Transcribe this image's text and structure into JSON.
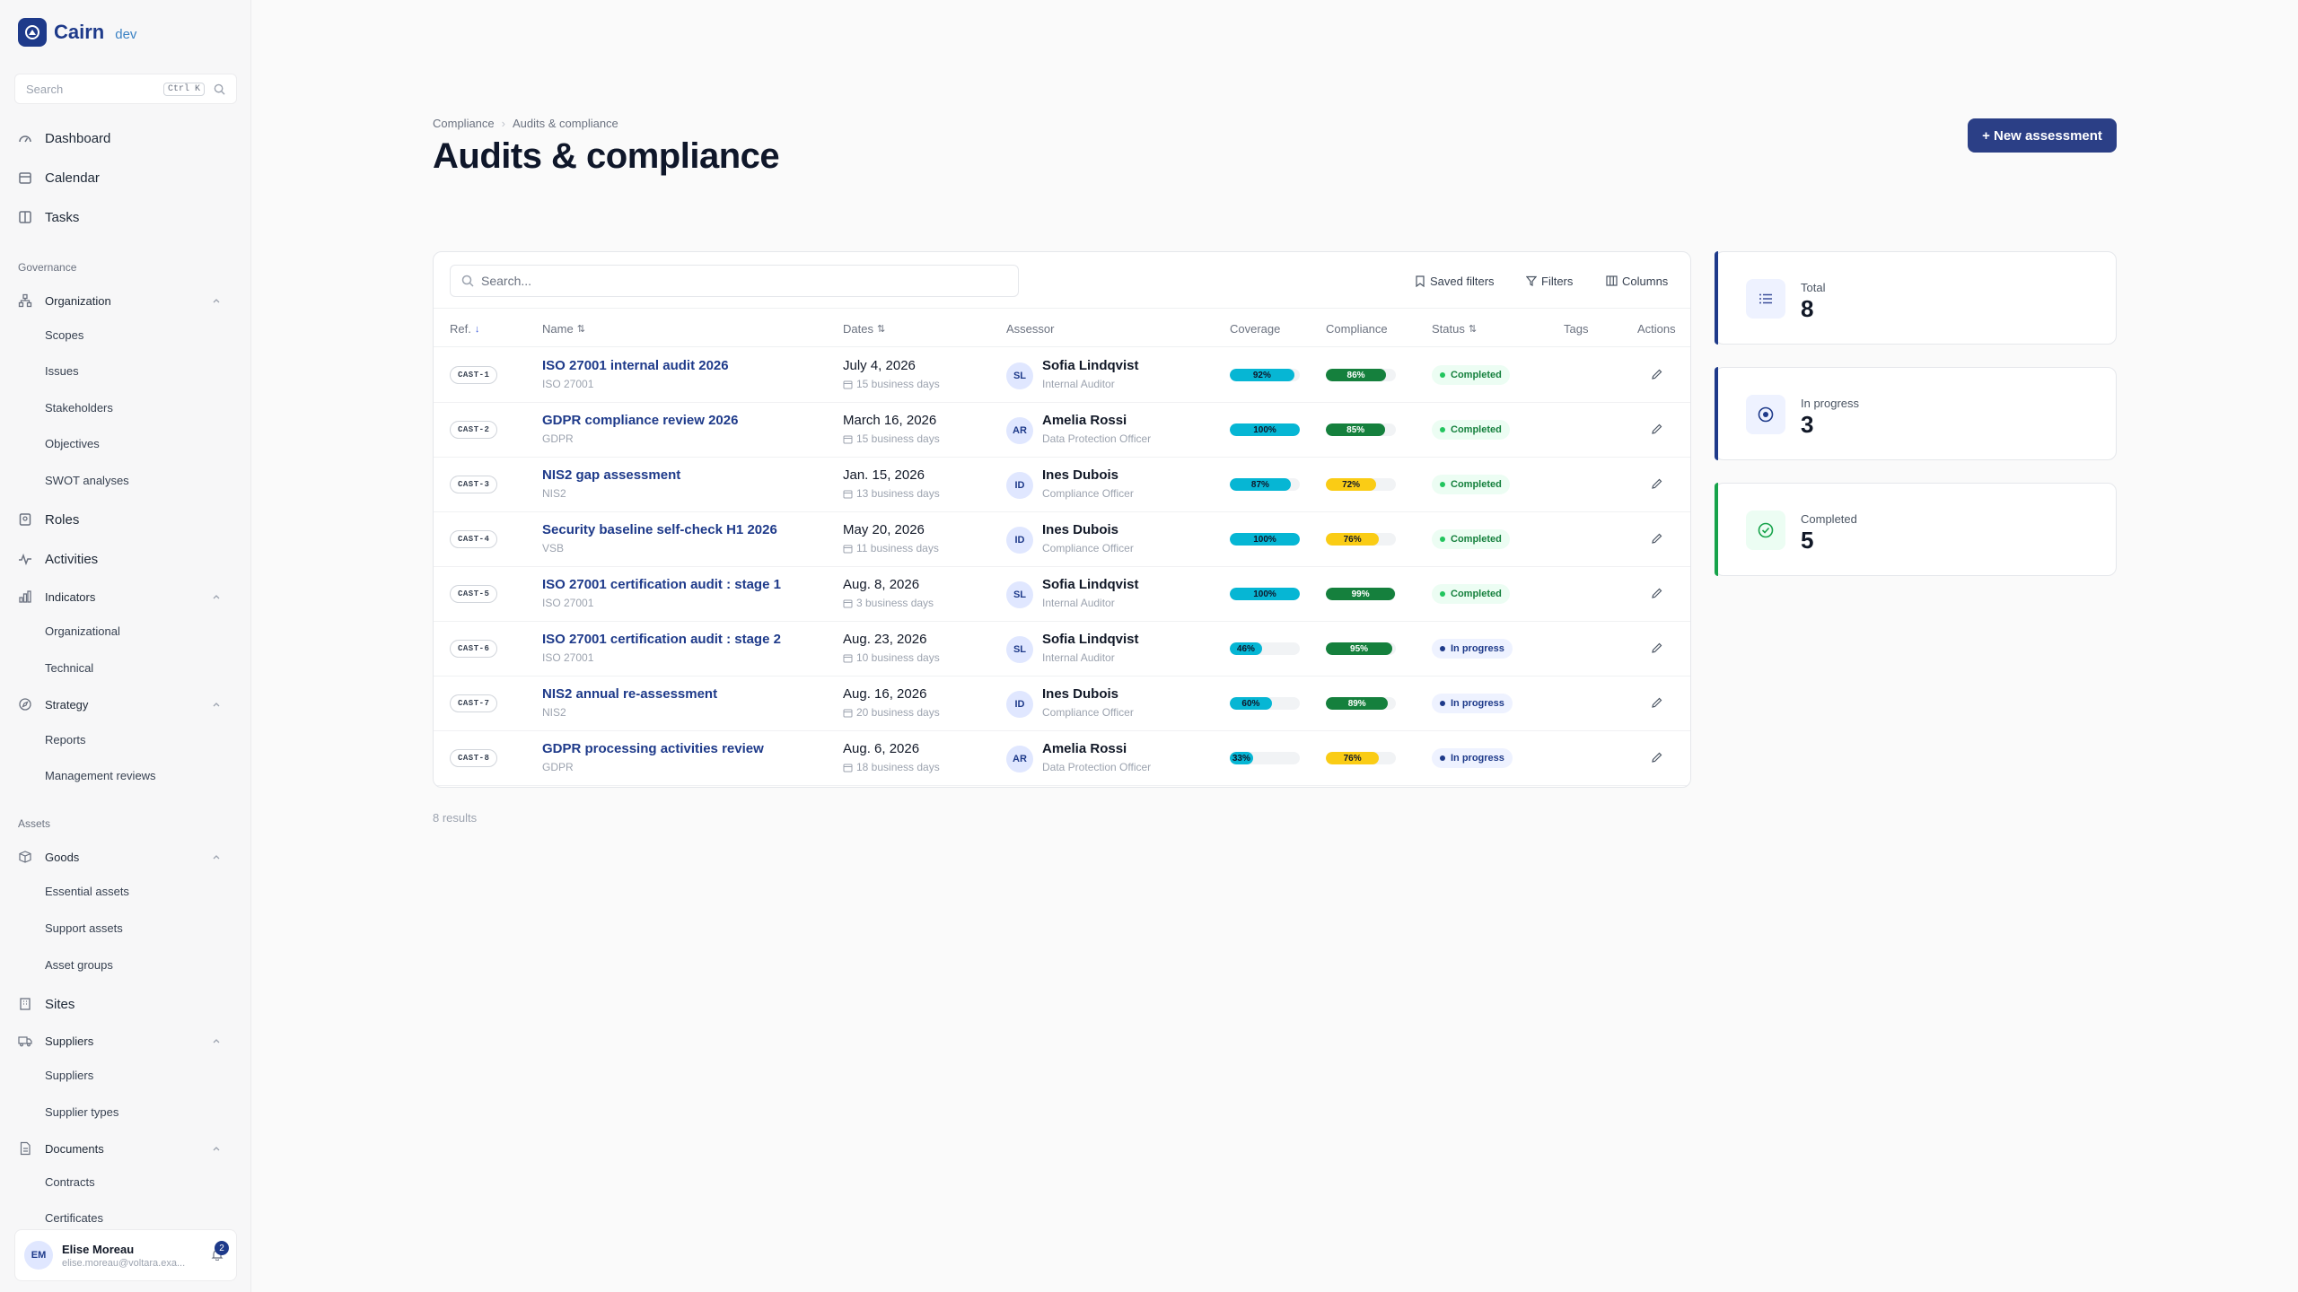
{
  "app": {
    "name": "Cairn",
    "env": "dev"
  },
  "sidebar": {
    "search_placeholder": "Search",
    "search_shortcut": "Ctrl K",
    "top_items": [
      {
        "label": "Dashboard",
        "icon": "dashboard-icon"
      },
      {
        "label": "Calendar",
        "icon": "calendar-icon"
      },
      {
        "label": "Tasks",
        "icon": "tasks-icon"
      }
    ],
    "governance_label": "Governance",
    "organization": {
      "label": "Organization",
      "children": [
        "Scopes",
        "Issues",
        "Stakeholders",
        "Objectives",
        "SWOT analyses"
      ]
    },
    "roles": "Roles",
    "activities": "Activities",
    "indicators": {
      "label": "Indicators",
      "children": [
        "Organizational",
        "Technical"
      ]
    },
    "strategy": {
      "label": "Strategy",
      "children": [
        "Reports",
        "Management reviews"
      ]
    },
    "assets_label": "Assets",
    "goods": {
      "label": "Goods",
      "children": [
        "Essential assets",
        "Support assets",
        "Asset groups"
      ]
    },
    "sites": "Sites",
    "suppliers": {
      "label": "Suppliers",
      "children": [
        "Suppliers",
        "Supplier types"
      ]
    },
    "documents": {
      "label": "Documents",
      "children": [
        "Contracts",
        "Certificates"
      ]
    },
    "user": {
      "initials": "EM",
      "name": "Elise Moreau",
      "email": "elise.moreau@voltara.exa...",
      "notifications": "2"
    }
  },
  "header": {
    "breadcrumb": [
      "Compliance",
      "Audits & compliance"
    ],
    "title": "Audits & compliance",
    "new_button": "+ New assessment"
  },
  "table": {
    "search_placeholder": "Search...",
    "toolbar": {
      "saved_filters": "Saved filters",
      "filters": "Filters",
      "columns": "Columns"
    },
    "columns": {
      "ref": "Ref.",
      "name": "Name",
      "dates": "Dates",
      "assessor": "Assessor",
      "coverage": "Coverage",
      "compliance": "Compliance",
      "status": "Status",
      "tags": "Tags",
      "actions": "Actions"
    },
    "rows": [
      {
        "ref": "CAST-1",
        "name": "ISO 27001 internal audit 2026",
        "framework": "ISO 27001",
        "date": "July 4, 2026",
        "duration": "15 business days",
        "initials": "SL",
        "assessor": "Sofia Lindqvist",
        "role": "Internal Auditor",
        "coverage": 92,
        "coverage_label": "92%",
        "compliance": 86,
        "compliance_label": "86%",
        "compliance_color": "#15803d",
        "status": "Completed"
      },
      {
        "ref": "CAST-2",
        "name": "GDPR compliance review 2026",
        "framework": "GDPR",
        "date": "March 16, 2026",
        "duration": "15 business days",
        "initials": "AR",
        "assessor": "Amelia Rossi",
        "role": "Data Protection Officer",
        "coverage": 100,
        "coverage_label": "100%",
        "compliance": 85,
        "compliance_label": "85%",
        "compliance_color": "#15803d",
        "status": "Completed"
      },
      {
        "ref": "CAST-3",
        "name": "NIS2 gap assessment",
        "framework": "NIS2",
        "date": "Jan. 15, 2026",
        "duration": "13 business days",
        "initials": "ID",
        "assessor": "Ines Dubois",
        "role": "Compliance Officer",
        "coverage": 87,
        "coverage_label": "87%",
        "compliance": 72,
        "compliance_label": "72%",
        "compliance_color": "#facc15",
        "status": "Completed"
      },
      {
        "ref": "CAST-4",
        "name": "Security baseline self-check H1 2026",
        "framework": "VSB",
        "date": "May 20, 2026",
        "duration": "11 business days",
        "initials": "ID",
        "assessor": "Ines Dubois",
        "role": "Compliance Officer",
        "coverage": 100,
        "coverage_label": "100%",
        "compliance": 76,
        "compliance_label": "76%",
        "compliance_color": "#facc15",
        "status": "Completed"
      },
      {
        "ref": "CAST-5",
        "name": "ISO 27001 certification audit : stage 1",
        "framework": "ISO 27001",
        "date": "Aug. 8, 2026",
        "duration": "3 business days",
        "initials": "SL",
        "assessor": "Sofia Lindqvist",
        "role": "Internal Auditor",
        "coverage": 100,
        "coverage_label": "100%",
        "compliance": 99,
        "compliance_label": "99%",
        "compliance_color": "#15803d",
        "status": "Completed"
      },
      {
        "ref": "CAST-6",
        "name": "ISO 27001 certification audit : stage 2",
        "framework": "ISO 27001",
        "date": "Aug. 23, 2026",
        "duration": "10 business days",
        "initials": "SL",
        "assessor": "Sofia Lindqvist",
        "role": "Internal Auditor",
        "coverage": 46,
        "coverage_label": "46%",
        "compliance": 95,
        "compliance_label": "95%",
        "compliance_color": "#15803d",
        "status": "In progress"
      },
      {
        "ref": "CAST-7",
        "name": "NIS2 annual re-assessment",
        "framework": "NIS2",
        "date": "Aug. 16, 2026",
        "duration": "20 business days",
        "initials": "ID",
        "assessor": "Ines Dubois",
        "role": "Compliance Officer",
        "coverage": 60,
        "coverage_label": "60%",
        "compliance": 89,
        "compliance_label": "89%",
        "compliance_color": "#15803d",
        "status": "In progress"
      },
      {
        "ref": "CAST-8",
        "name": "GDPR processing activities review",
        "framework": "GDPR",
        "date": "Aug. 6, 2026",
        "duration": "18 business days",
        "initials": "AR",
        "assessor": "Amelia Rossi",
        "role": "Data Protection Officer",
        "coverage": 33,
        "coverage_label": "33%",
        "compliance": 76,
        "compliance_label": "76%",
        "compliance_color": "#facc15",
        "status": "In progress"
      }
    ],
    "results": "8 results"
  },
  "stats": [
    {
      "label": "Total",
      "value": "8",
      "color": "#1e3a8a",
      "icon": "list-icon"
    },
    {
      "label": "In progress",
      "value": "3",
      "color": "#1e3a8a",
      "icon": "target-icon"
    },
    {
      "label": "Completed",
      "value": "5",
      "color": "#16a34a",
      "icon": "check-circle-icon"
    }
  ],
  "colors": {
    "accent": "#2b3f86",
    "coverage_bar": "#06b6d4",
    "completed": "#16a34a",
    "in_progress": "#1e3a8a"
  }
}
